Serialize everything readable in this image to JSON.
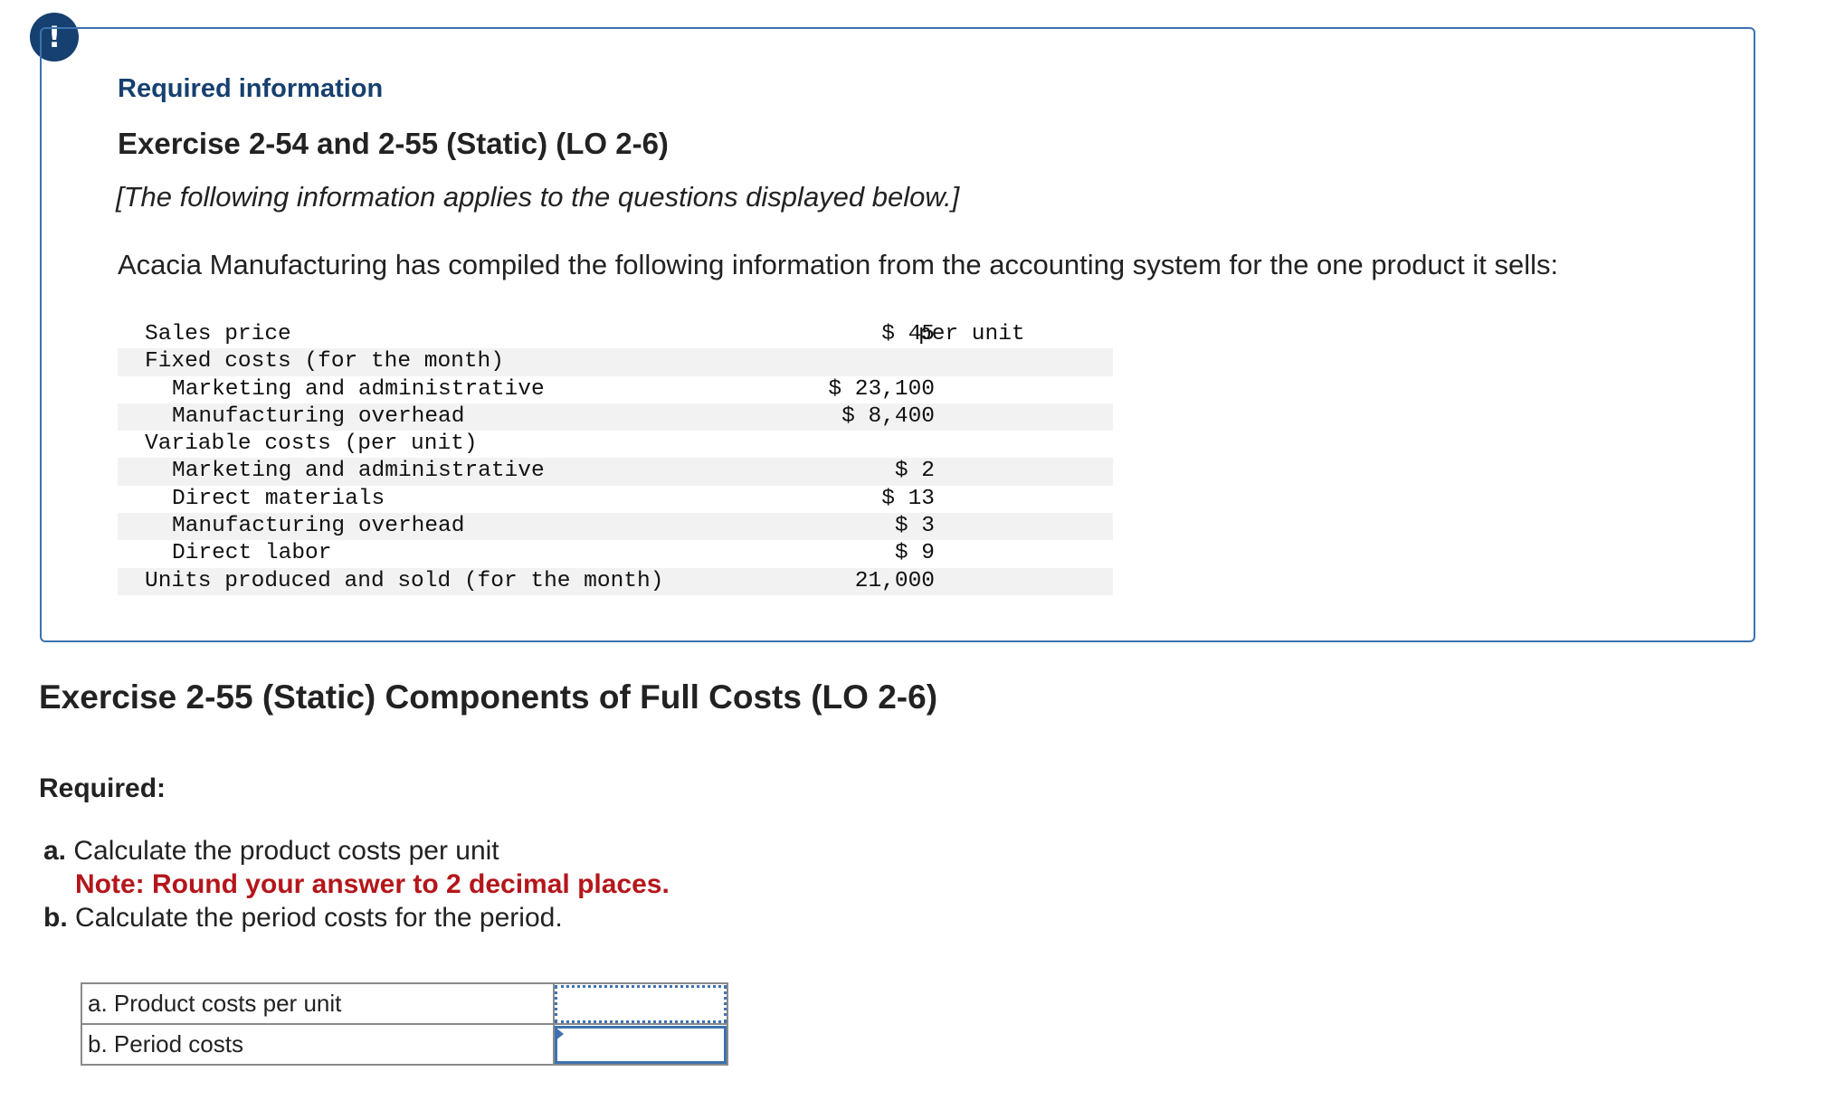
{
  "alert_icon": "!",
  "info": {
    "required_label": "Required information",
    "exercise_title": "Exercise 2-54 and 2-55 (Static) (LO 2-6)",
    "applies_text": "[The following information applies to the questions displayed below.]",
    "intro": "Acacia Manufacturing has compiled the following information from the accounting system for the one product it sells:"
  },
  "data_rows": [
    {
      "label": "Sales price",
      "value": "$ 45",
      "unit": "per unit"
    },
    {
      "label": "Fixed costs (for the month)",
      "value": "",
      "unit": ""
    },
    {
      "label": "Marketing and administrative",
      "value": "$ 23,100",
      "unit": ""
    },
    {
      "label": "Manufacturing overhead",
      "value": "$ 8,400",
      "unit": ""
    },
    {
      "label": "Variable costs (per unit)",
      "value": "",
      "unit": ""
    },
    {
      "label": "Marketing and administrative",
      "value": "$ 2",
      "unit": ""
    },
    {
      "label": "Direct materials",
      "value": "$ 13",
      "unit": ""
    },
    {
      "label": "Manufacturing overhead",
      "value": "$ 3",
      "unit": ""
    },
    {
      "label": "Direct labor",
      "value": "$ 9",
      "unit": ""
    },
    {
      "label": "Units produced and sold (for the month)",
      "value": "21,000",
      "unit": ""
    }
  ],
  "part": {
    "title": "Exercise 2-55 (Static) Components of Full Costs (LO 2-6)",
    "required_label": "Required:",
    "item_a_prefix": "a.",
    "item_a_text": "Calculate the product costs per unit",
    "item_a_note": "Note: Round your answer to 2 decimal places.",
    "item_b_prefix": "b.",
    "item_b_text": "Calculate the period costs for the period."
  },
  "answers": {
    "row_a_label": "a. Product costs per unit",
    "row_a_value": "",
    "row_b_label": "b. Period costs",
    "row_b_value": ""
  }
}
